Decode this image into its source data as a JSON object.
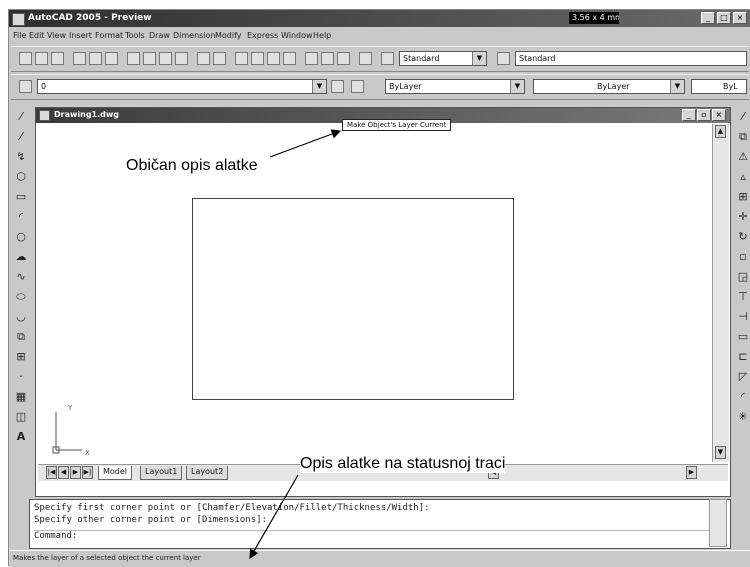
{
  "window": {
    "title": "AutoCAD 2005 - Preview",
    "status_box": "3.56 x 4 mm"
  },
  "menu": [
    "File",
    "Edit",
    "View",
    "Insert",
    "Format",
    "Tools",
    "Draw",
    "Dimension",
    "Modify",
    "Express",
    "Window",
    "Help"
  ],
  "toolbar1": {
    "text_style": "Standard",
    "dim_style": "Standard"
  },
  "toolbar2": {
    "layer": "0",
    "color": "ByLayer",
    "linetype": "ByLayer",
    "lineweight": "ByL"
  },
  "drawing": {
    "title": "Drawing1.dwg",
    "tooltip": "Make Object's Layer Current",
    "ucs_y": "Y",
    "ucs_x": "X",
    "tabs": [
      "Model",
      "Layout1",
      "Layout2"
    ]
  },
  "command": {
    "lines": [
      "Specify first corner point or [Chamfer/Elevation/Fillet/Thickness/Width]:",
      "Specify other corner point or [Dimensions]:",
      "Command:"
    ]
  },
  "statusbar": {
    "text": "Makes the layer of a selected object the current layer"
  },
  "annotations": {
    "tooltip_label": "Običan opis alatke",
    "status_label": "Opis alatke na statusnoj traci"
  }
}
